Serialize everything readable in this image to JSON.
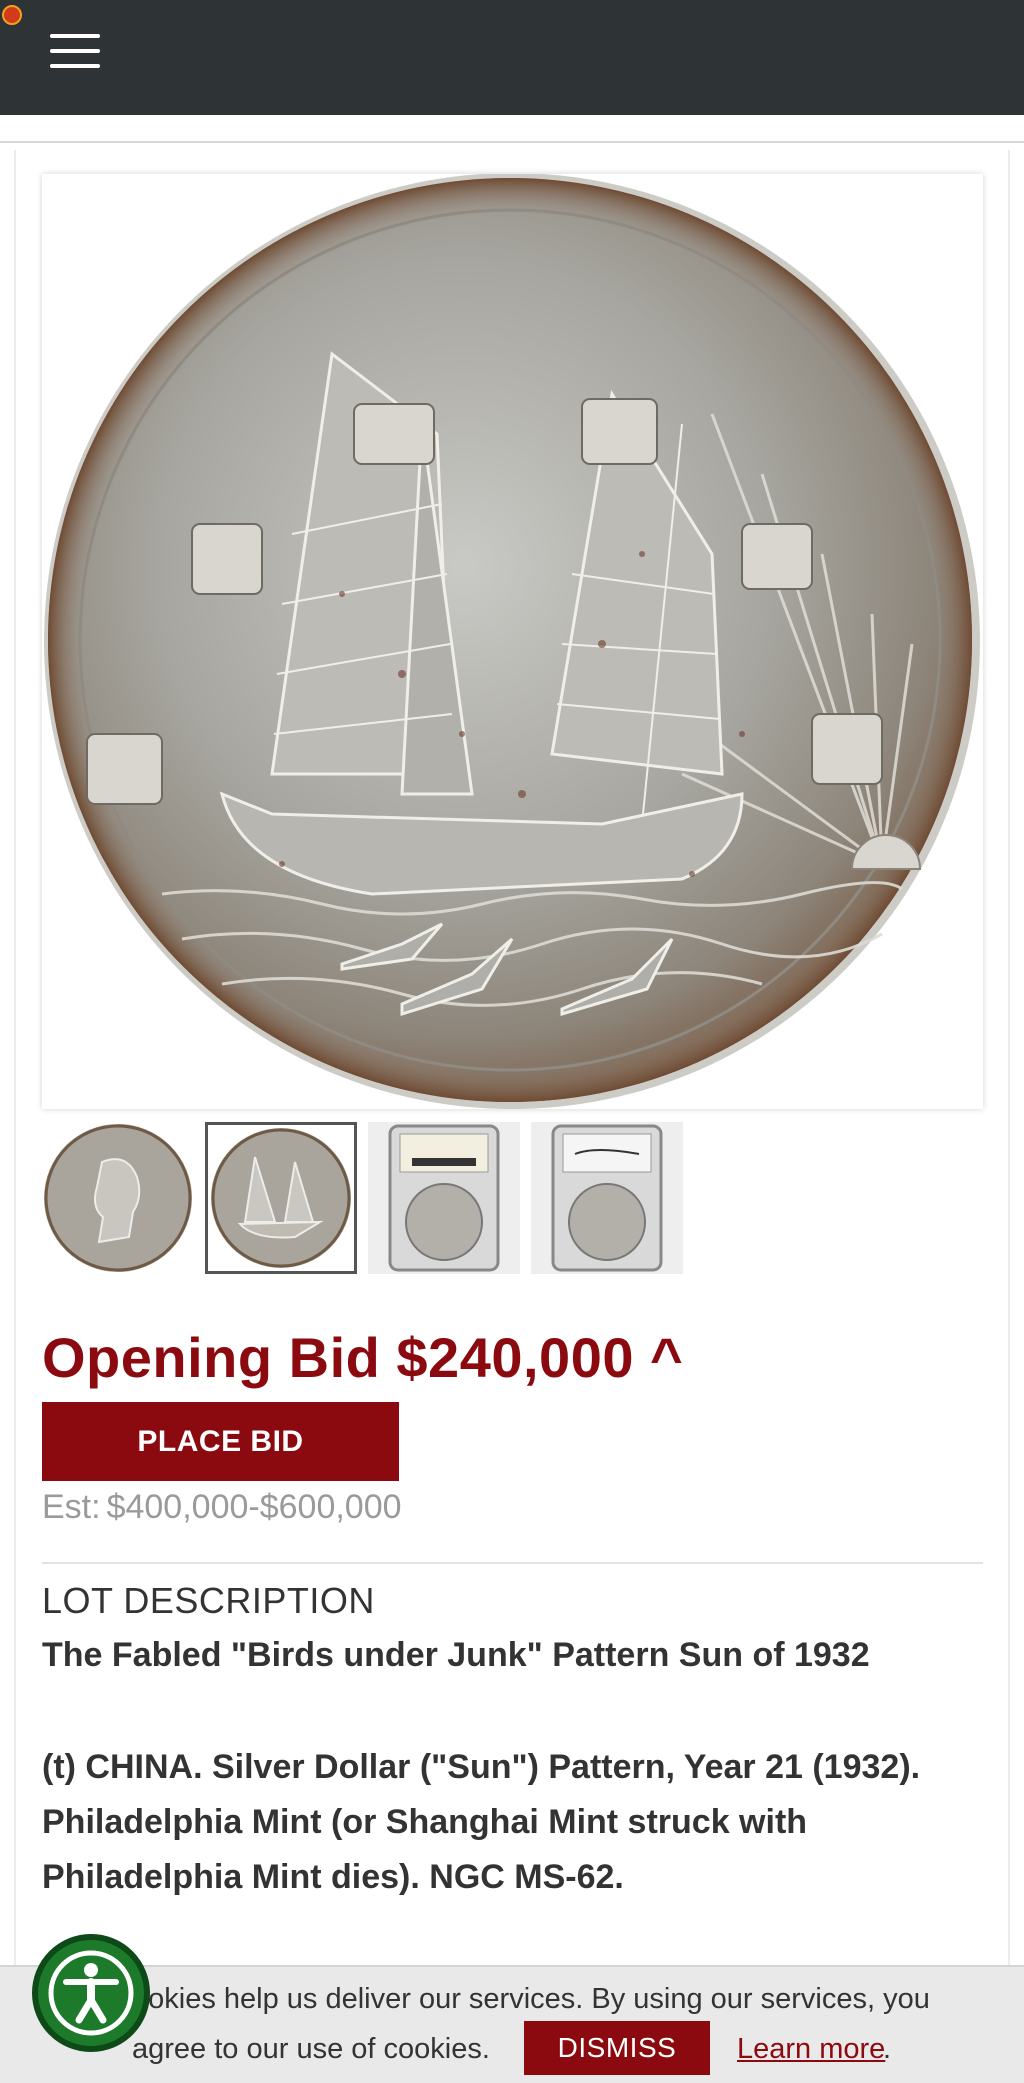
{
  "header": {
    "menu_icon": "hamburger-menu-icon",
    "logo_icon": "site-logo-icon",
    "logo_text": "",
    "background": "#2e3436"
  },
  "gallery": {
    "main_image": "coin-reverse-junk-ship",
    "thumbnails": [
      {
        "name": "coin-obverse-portrait",
        "active": false
      },
      {
        "name": "coin-reverse-junk",
        "active": true
      },
      {
        "name": "ngc-slab-front",
        "active": false
      },
      {
        "name": "ngc-slab-back",
        "active": false
      }
    ]
  },
  "bid": {
    "opening_text": "Opening Bid $240,000 ^",
    "place_bid_label": "PLACE BID",
    "estimate_label": "Est:",
    "estimate_value": "$400,000-$600,000"
  },
  "lot": {
    "heading": "LOT DESCRIPTION",
    "title": "The Fabled \"Birds under Junk\" Pattern Sun of 1932",
    "body": "(t) CHINA. Silver Dollar (\"Sun\") Pattern, Year 21 (1932). Philadelphia Mint (or Shanghai Mint struck with Philadelphia Mint dies). NGC MS-62."
  },
  "cookie": {
    "line1": "ookies help us deliver our services. By using our services, you",
    "line2": "agree to our use of cookies.",
    "dismiss_label": "DISMISS",
    "learn_more_label": "Learn more",
    "period": "."
  },
  "accessibility": {
    "icon": "accessibility-icon"
  },
  "colors": {
    "brand_red": "#8b0a10",
    "accessibility_green": "#1c7a2a",
    "estimate_gray": "#9a9a9a"
  }
}
